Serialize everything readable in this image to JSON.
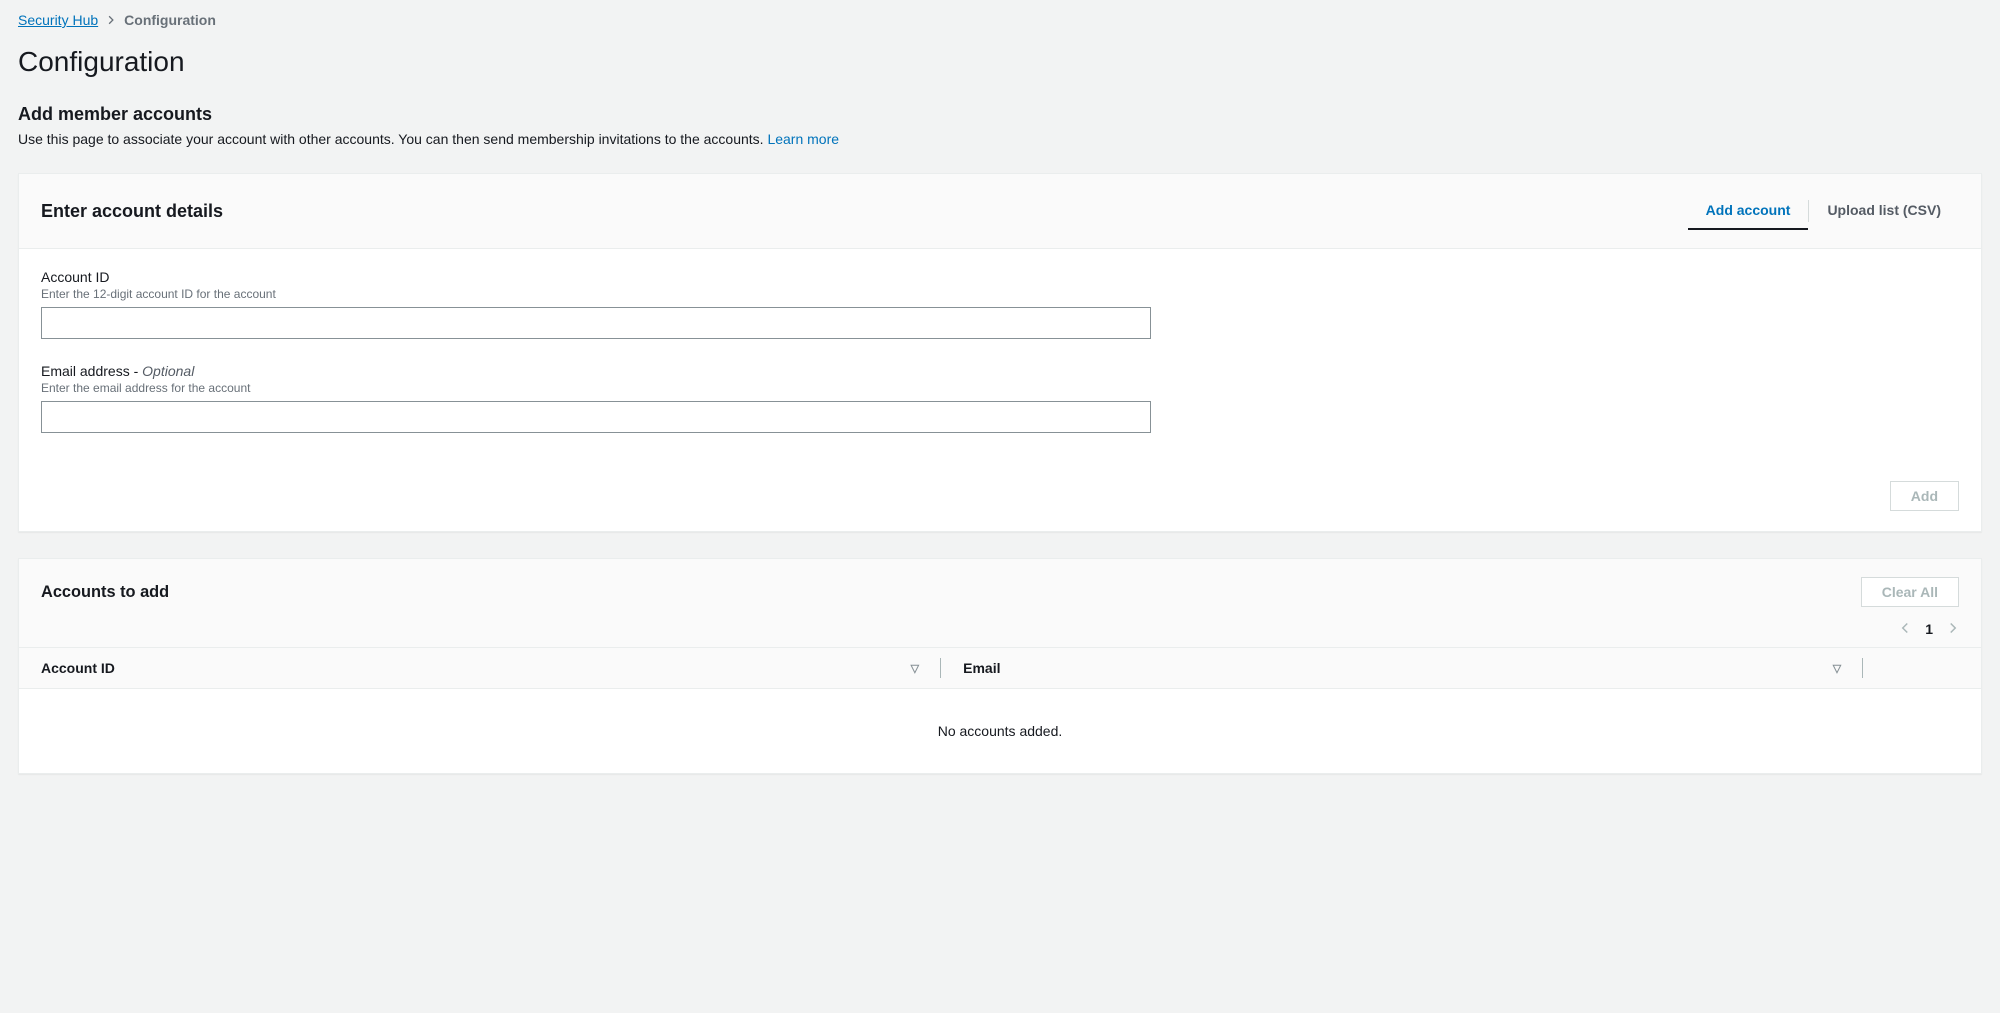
{
  "breadcrumb": {
    "root": "Security Hub",
    "current": "Configuration"
  },
  "page": {
    "title": "Configuration",
    "subtitle": "Add member accounts",
    "description": "Use this page to associate your account with other accounts. You can then send membership invitations to the accounts. ",
    "learn_more": "Learn more"
  },
  "enter_panel": {
    "title": "Enter account details",
    "tabs": {
      "add": "Add account",
      "upload": "Upload list (CSV)"
    },
    "account_id": {
      "label": "Account ID",
      "help": "Enter the 12-digit account ID for the account"
    },
    "email": {
      "label": "Email address - ",
      "optional": "Optional",
      "help": "Enter the email address for the account"
    },
    "add_button": "Add"
  },
  "accounts_panel": {
    "title": "Accounts to add",
    "clear_all": "Clear All",
    "page": "1",
    "columns": {
      "account_id": "Account ID",
      "email": "Email"
    },
    "empty": "No accounts added."
  }
}
